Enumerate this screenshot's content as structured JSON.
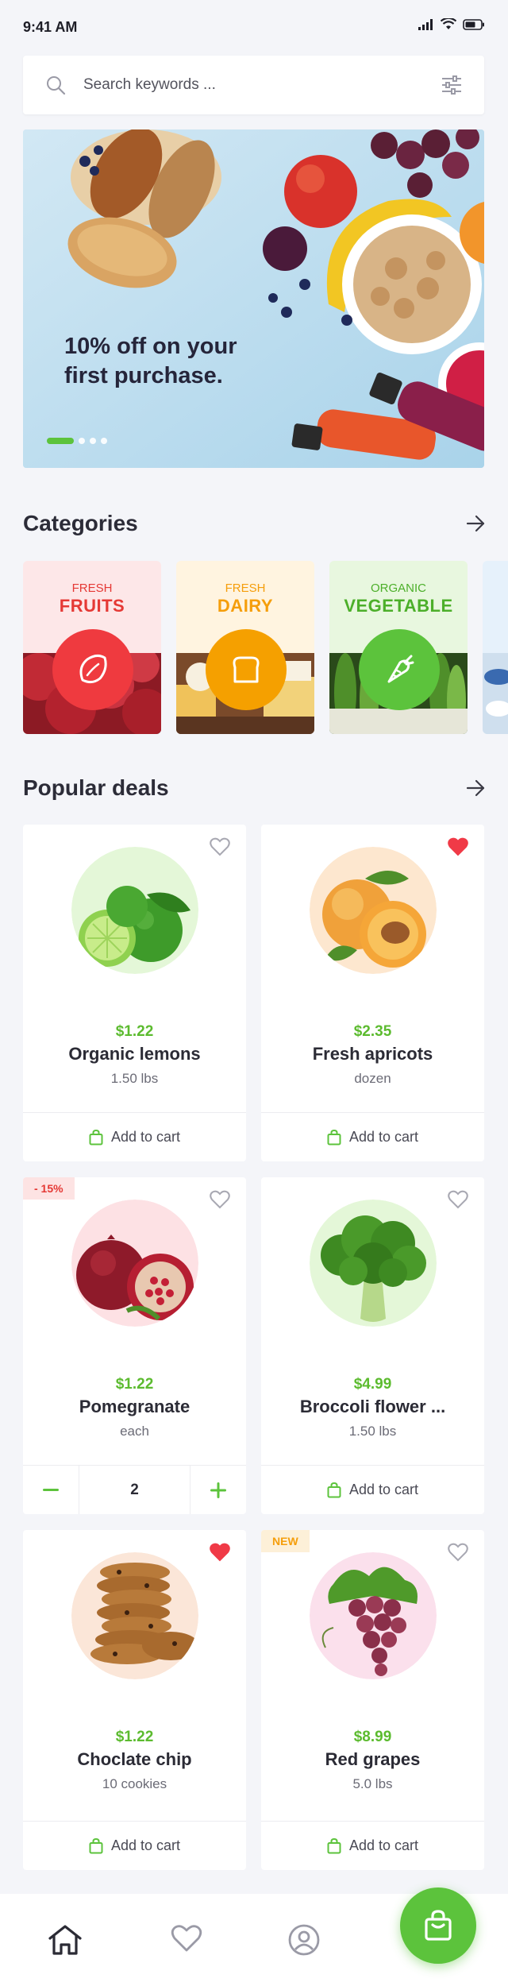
{
  "status": {
    "time": "9:41 AM"
  },
  "search": {
    "placeholder": "Search keywords ..."
  },
  "banner": {
    "text": "10% off on your first purchase."
  },
  "categories": {
    "title": "Categories",
    "items": [
      {
        "small": "FRESH",
        "large": "FRUITS",
        "color": "#e53935"
      },
      {
        "small": "FRESH",
        "large": "DAIRY",
        "color": "#f59e0b"
      },
      {
        "small": "ORGANIC",
        "large": "VEGETABLE",
        "color": "#4caf2a"
      }
    ]
  },
  "deals": {
    "title": "Popular deals",
    "add_label": "Add to cart",
    "products": [
      {
        "price": "$1.22",
        "name": "Organic lemons",
        "unit": "1.50 lbs",
        "favorite": false
      },
      {
        "price": "$2.35",
        "name": "Fresh apricots",
        "unit": "dozen",
        "favorite": true
      },
      {
        "price": "$1.22",
        "name": "Pomegranate",
        "unit": "each",
        "favorite": false,
        "badge": "- 15%",
        "quantity": "2"
      },
      {
        "price": "$4.99",
        "name": "Broccoli flower ...",
        "unit": "1.50 lbs",
        "favorite": false
      },
      {
        "price": "$1.22",
        "name": "Choclate chip",
        "unit": "10 cookies",
        "favorite": true
      },
      {
        "price": "$8.99",
        "name": "Red grapes",
        "unit": "5.0 lbs",
        "favorite": false,
        "badge": "NEW"
      }
    ]
  },
  "colors": {
    "accent": "#5cc33c",
    "heart": "#f03a47"
  }
}
